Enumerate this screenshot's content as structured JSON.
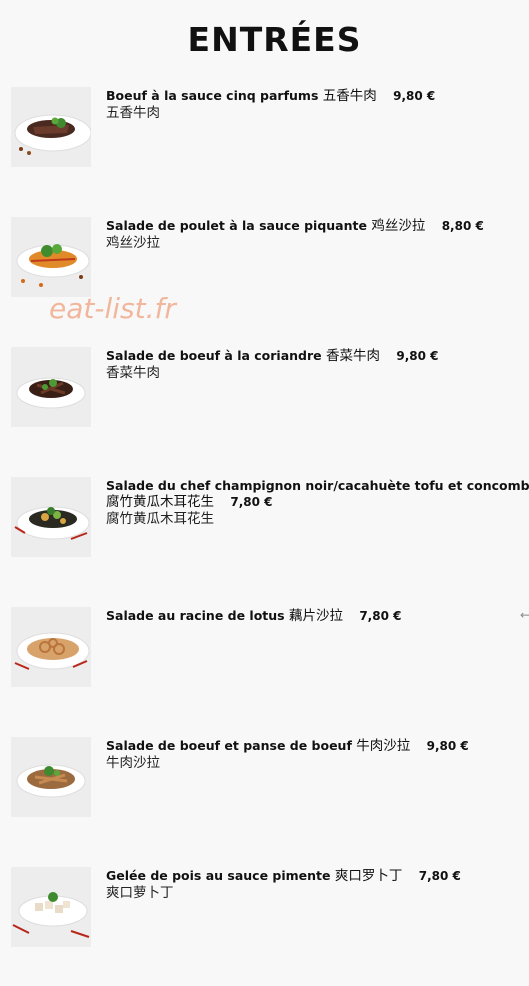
{
  "page": {
    "title": "ENTRÉES",
    "watermark": "eat-list.fr"
  },
  "items": [
    {
      "name": "Boeuf à la sauce cinq parfums",
      "name_cn": "五香牛肉",
      "price": "9,80 €",
      "subtitle": "五香牛肉",
      "image": "beef-five-spice-dish"
    },
    {
      "name": "Salade de poulet à la sauce piquante",
      "name_cn": "鸡丝沙拉",
      "price": "8,80 €",
      "subtitle": "鸡丝沙拉",
      "image": "spicy-chicken-salad-dish"
    },
    {
      "name": "Salade de boeuf à la coriandre",
      "name_cn": "香菜牛肉",
      "price": "9,80 €",
      "subtitle": "香菜牛肉",
      "image": "coriander-beef-salad-dish"
    },
    {
      "name": "Salade du chef champignon noir/cacahuète tofu et concombre",
      "name_cn": "腐竹黄瓜木耳花生",
      "price": "7,80 €",
      "subtitle": "腐竹黄瓜木耳花生",
      "image": "chef-salad-dish"
    },
    {
      "name": "Salade au racine de lotus",
      "name_cn": "藕片沙拉",
      "price": "7,80 €",
      "subtitle": "",
      "image": "lotus-root-salad-dish"
    },
    {
      "name": "Salade de boeuf et panse de boeuf",
      "name_cn": "牛肉沙拉",
      "price": "9,80 €",
      "subtitle": "牛肉沙拉",
      "image": "beef-tripe-salad-dish"
    },
    {
      "name": "Gelée de pois au sauce pimente",
      "name_cn": "爽口罗卜丁",
      "price": "7,80 €",
      "subtitle": "爽口萝卜丁",
      "image": "pea-jelly-dish"
    }
  ],
  "colors": {
    "background": "#f8f8f8",
    "watermark": "#f1b79d",
    "text": "#111111"
  }
}
